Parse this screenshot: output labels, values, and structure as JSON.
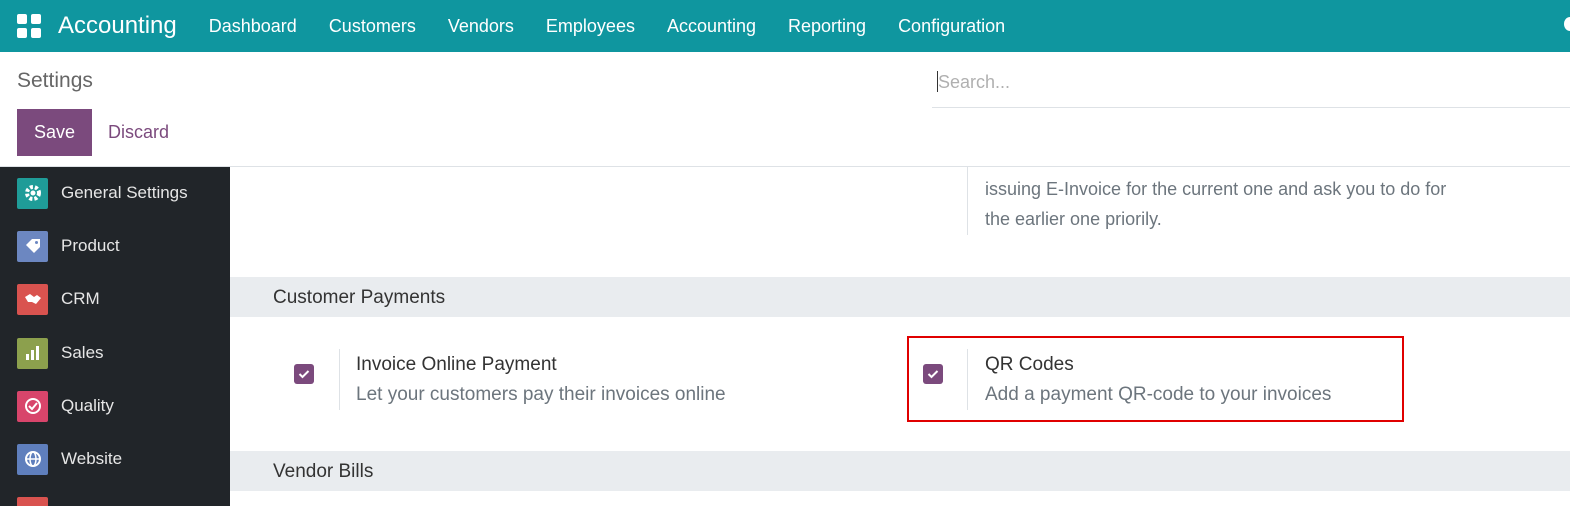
{
  "navbar": {
    "app_name": "Accounting",
    "menu": [
      "Dashboard",
      "Customers",
      "Vendors",
      "Employees",
      "Accounting",
      "Reporting",
      "Configuration"
    ]
  },
  "control_panel": {
    "title": "Settings",
    "save_label": "Save",
    "discard_label": "Discard",
    "search_placeholder": "Search..."
  },
  "sidebar": {
    "items": [
      {
        "label": "General Settings",
        "icon": "gear-icon",
        "color": "#1f9c98"
      },
      {
        "label": "Product",
        "icon": "tag-icon",
        "color": "#6c87c1"
      },
      {
        "label": "CRM",
        "icon": "handshake-icon",
        "color": "#d9534f"
      },
      {
        "label": "Sales",
        "icon": "chart-icon",
        "color": "#8ca04d"
      },
      {
        "label": "Quality",
        "icon": "check-circle-icon",
        "color": "#d8456b"
      },
      {
        "label": "Website",
        "icon": "globe-icon",
        "color": "#5f7fbd"
      }
    ]
  },
  "content": {
    "top_text_line1": "issuing E-Invoice for the current one and ask you to do for",
    "top_text_line2": "the earlier one priorily.",
    "customer_payments": {
      "title": "Customer Payments",
      "settings": [
        {
          "title": "Invoice Online Payment",
          "description": "Let your customers pay their invoices online",
          "checked": true
        },
        {
          "title": "QR Codes",
          "description": "Add a payment QR-code to your invoices",
          "checked": true
        }
      ]
    },
    "vendor_bills": {
      "title": "Vendor Bills"
    }
  },
  "colors": {
    "navbar": "#0f969f",
    "primary": "#7b4a7d",
    "highlight": "#e00000",
    "sidebar": "#212529"
  }
}
